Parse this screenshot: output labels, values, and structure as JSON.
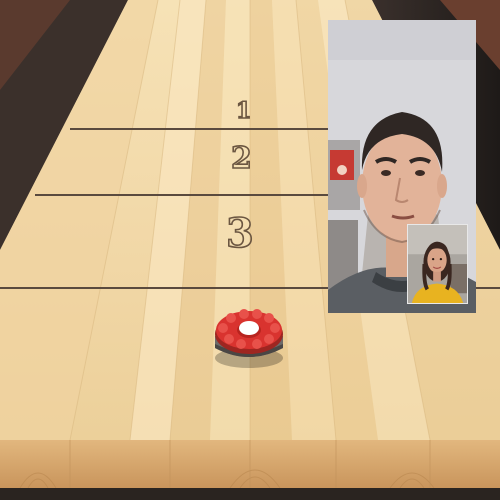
{
  "game": {
    "zones": [
      {
        "label": "1"
      },
      {
        "label": "2"
      },
      {
        "label": "3"
      }
    ],
    "puck": {
      "color": "#d9332f",
      "center_color": "#ffffff",
      "icon": "shuffleboard-puck-icon"
    },
    "board": {
      "wood_light": "#f3dcae",
      "wood_mid": "#e6c48f",
      "line_color": "#5a4a3e"
    }
  },
  "video_call": {
    "remote_participant": {
      "icon": "remote-video-feed"
    },
    "self_view": {
      "icon": "self-video-feed"
    }
  }
}
